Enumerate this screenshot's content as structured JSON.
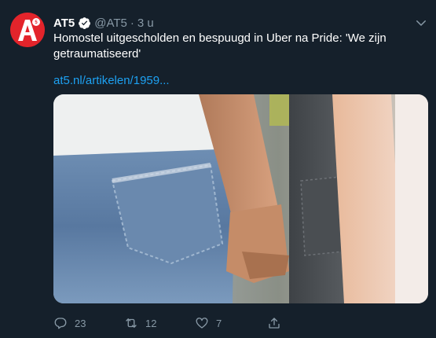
{
  "colors": {
    "background": "#15202b",
    "secondary_text": "#8899a6",
    "link": "#1da1f2",
    "brand": "#e3242b"
  },
  "tweet": {
    "author": {
      "avatar_text": "A",
      "name": "AT5",
      "verified": true,
      "handle": "@AT5",
      "separator": "·",
      "time": "3 u"
    },
    "text": "Homostel uitgescholden en bespuugd in Uber na Pride: 'We zijn getraumatiseerd'",
    "link": "at5.nl/artikelen/1959...",
    "media": {
      "description": "photo"
    },
    "actions": {
      "reply": {
        "icon": "reply-icon",
        "count": "23"
      },
      "retweet": {
        "icon": "retweet-icon",
        "count": "12"
      },
      "like": {
        "icon": "like-icon",
        "count": "7"
      },
      "share": {
        "icon": "share-icon"
      }
    }
  }
}
